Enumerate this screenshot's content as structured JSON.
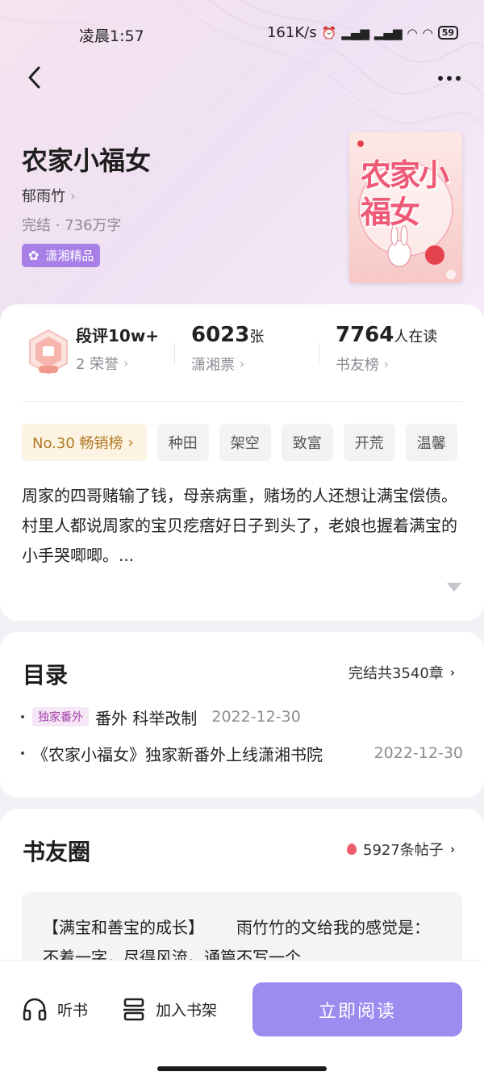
{
  "status_bar": {
    "time": "凌晨1:57",
    "net_speed": "161K/s",
    "battery": "59"
  },
  "book": {
    "title": "农家小福女",
    "author": "郁雨竹",
    "meta": "完结 · 736万字",
    "badge": "潇湘精品",
    "cover_title": "农家小福女"
  },
  "stats": {
    "honor": {
      "main": "段评10w+",
      "sub": "2 荣誉"
    },
    "tickets": {
      "value": "6023",
      "unit": "张",
      "sub": "潇湘票"
    },
    "readers": {
      "value": "7764",
      "unit": "人在读",
      "sub": "书友榜"
    }
  },
  "tags": {
    "rank": "No.30 畅销榜",
    "items": [
      "种田",
      "架空",
      "致富",
      "开荒",
      "温馨"
    ]
  },
  "synopsis": {
    "line1": "周家的四哥赌输了钱，母亲病重，赌场的人还想让满宝偿债。",
    "line2": "村里人都说周家的宝贝疙瘩好日子到头了，老娘也握着满宝的小手哭唧唧。..."
  },
  "toc": {
    "title": "目录",
    "summary": "完结共3540章",
    "items": [
      {
        "badge": "独家番外",
        "title": "番外 科举改制",
        "date": "2022-12-30"
      },
      {
        "title": "《农家小福女》独家新番外上线潇湘书院",
        "date": "2022-12-30"
      }
    ]
  },
  "circle": {
    "title": "书友圈",
    "count": "5927条帖子",
    "post_heading": "【满宝和善宝的成长】",
    "post_text": "雨竹竹的文给我的感觉是：不着一字，尽得风流。通篇不写一个"
  },
  "bottom_bar": {
    "listen": "听书",
    "shelf": "加入书架",
    "read": "立即阅读"
  }
}
